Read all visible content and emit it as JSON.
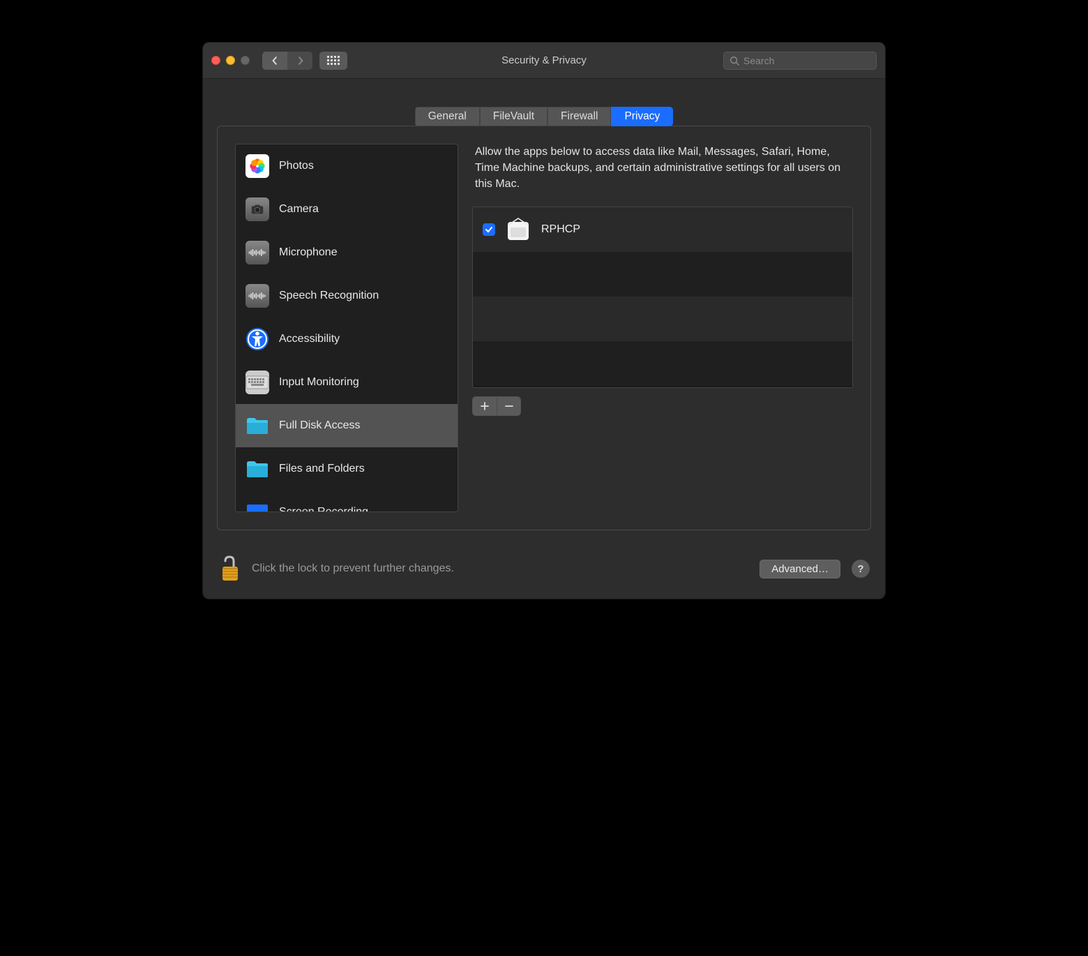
{
  "window": {
    "title": "Security & Privacy"
  },
  "search": {
    "placeholder": "Search"
  },
  "tabs": [
    {
      "label": "General",
      "active": false
    },
    {
      "label": "FileVault",
      "active": false
    },
    {
      "label": "Firewall",
      "active": false
    },
    {
      "label": "Privacy",
      "active": true
    }
  ],
  "sidebar": {
    "items": [
      {
        "label": "Photos",
        "icon": "photos"
      },
      {
        "label": "Camera",
        "icon": "camera"
      },
      {
        "label": "Microphone",
        "icon": "microphone"
      },
      {
        "label": "Speech Recognition",
        "icon": "speech"
      },
      {
        "label": "Accessibility",
        "icon": "accessibility"
      },
      {
        "label": "Input Monitoring",
        "icon": "keyboard"
      },
      {
        "label": "Full Disk Access",
        "icon": "folder",
        "selected": true
      },
      {
        "label": "Files and Folders",
        "icon": "folder"
      },
      {
        "label": "Screen Recording",
        "icon": "display"
      }
    ]
  },
  "main": {
    "description": "Allow the apps below to access data like Mail, Messages, Safari, Home, Time Machine backups, and certain administrative settings for all users on this Mac.",
    "apps": [
      {
        "name": "RPHCP",
        "checked": true
      }
    ]
  },
  "footer": {
    "lock_text": "Click the lock to prevent further changes.",
    "advanced_label": "Advanced…",
    "help_label": "?"
  }
}
